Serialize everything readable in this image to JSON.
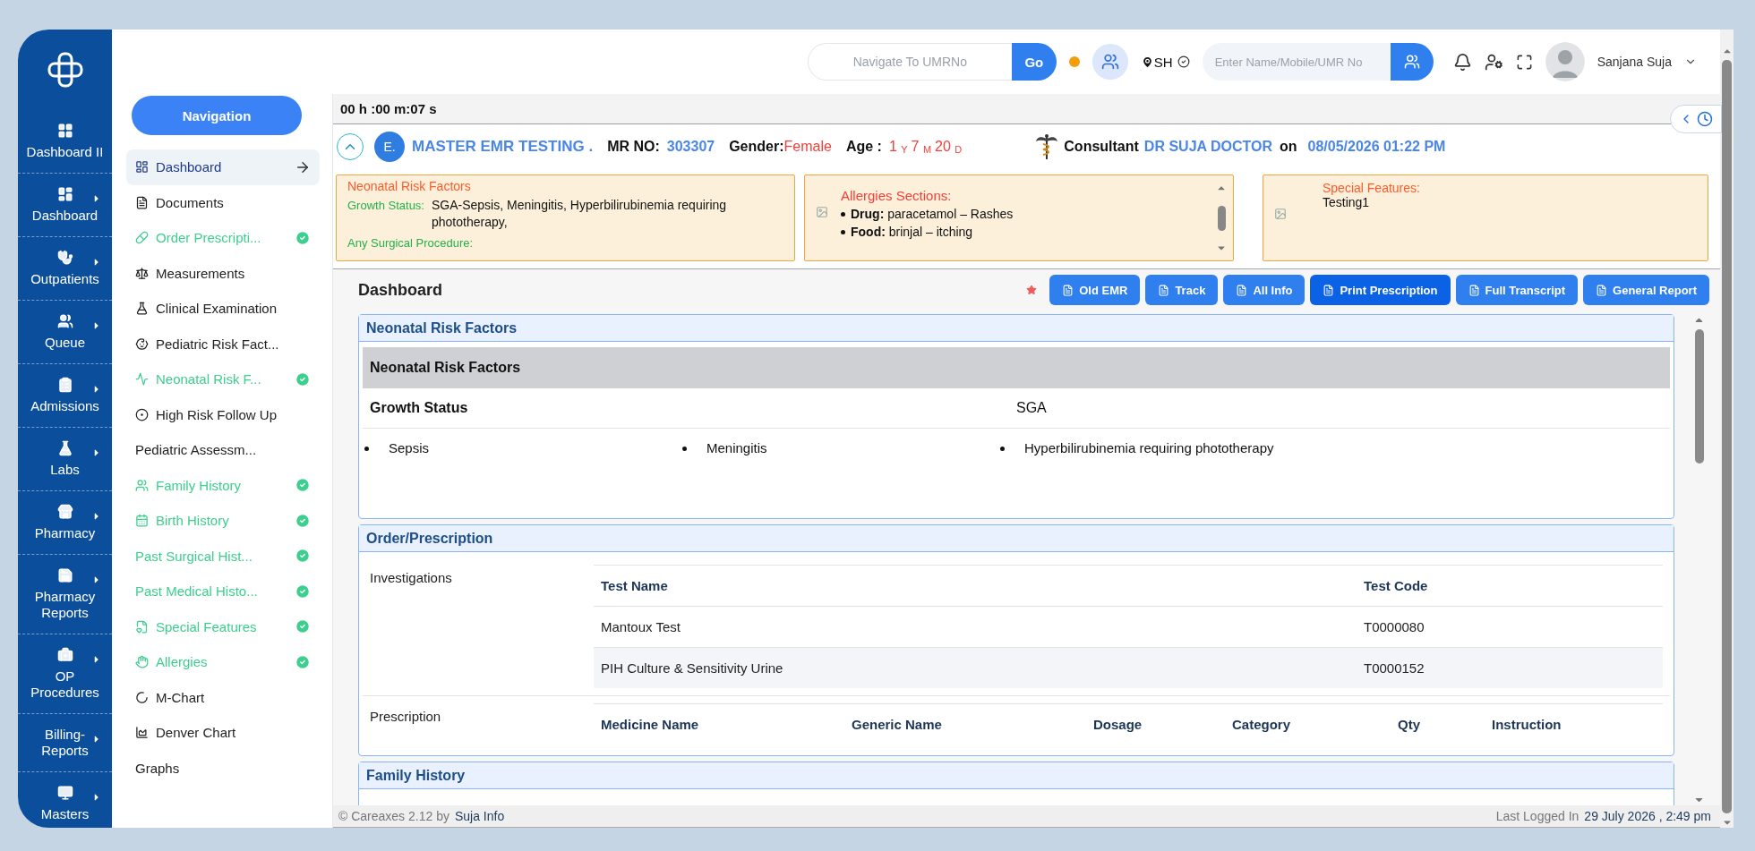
{
  "sidebar": {
    "items": [
      {
        "label": "Dashboard II",
        "submenu": false
      },
      {
        "label": "Dashboard",
        "submenu": true
      },
      {
        "label": "Outpatients",
        "submenu": true
      },
      {
        "label": "Queue",
        "submenu": true
      },
      {
        "label": "Admissions",
        "submenu": true
      },
      {
        "label": "Labs",
        "submenu": true
      },
      {
        "label": "Pharmacy",
        "submenu": true
      },
      {
        "label": "Pharmacy Reports",
        "submenu": true
      },
      {
        "label": "OP Procedures",
        "submenu": true
      },
      {
        "label": "Billing-Reports",
        "submenu": true
      },
      {
        "label": "Masters",
        "submenu": true
      }
    ]
  },
  "header": {
    "umr_search": {
      "placeholder": "Navigate To UMRNo",
      "button": "Go"
    },
    "location": "SH",
    "patient_search": {
      "placeholder": "Enter Name/Mobile/UMR No"
    },
    "user": "Sanjana Suja"
  },
  "navigation": {
    "title": "Navigation",
    "items": [
      {
        "label": "Dashboard",
        "selected": true,
        "completed": false
      },
      {
        "label": "Documents",
        "selected": false,
        "completed": false
      },
      {
        "label": "Order Prescripti...",
        "selected": false,
        "completed": true
      },
      {
        "label": "Measurements",
        "selected": false,
        "completed": false
      },
      {
        "label": "Clinical Examination",
        "selected": false,
        "completed": false
      },
      {
        "label": "Pediatric Risk Fact...",
        "selected": false,
        "completed": false
      },
      {
        "label": "Neonatal Risk F...",
        "selected": false,
        "completed": true
      },
      {
        "label": "High Risk Follow Up",
        "selected": false,
        "completed": false
      },
      {
        "label": "Pediatric Assessm...",
        "selected": false,
        "completed": false
      },
      {
        "label": "Family History",
        "selected": false,
        "completed": true
      },
      {
        "label": "Birth History",
        "selected": false,
        "completed": true
      },
      {
        "label": "Past Surgical Hist...",
        "selected": false,
        "completed": true
      },
      {
        "label": "Past Medical Histo...",
        "selected": false,
        "completed": true
      },
      {
        "label": "Special Features",
        "selected": false,
        "completed": true
      },
      {
        "label": "Allergies",
        "selected": false,
        "completed": true
      },
      {
        "label": "M-Chart",
        "selected": false,
        "completed": false
      },
      {
        "label": "Denver Chart",
        "selected": false,
        "completed": false
      },
      {
        "label": "Graphs",
        "selected": false,
        "completed": false
      }
    ]
  },
  "timer": "00 h :00 m:07 s",
  "patient": {
    "initial": "E.",
    "name": "MASTER EMR TESTING .",
    "mr_label": "MR NO:",
    "mr_no": "303307",
    "gender_label": "Gender:",
    "gender": "Female",
    "age_label": "Age :",
    "age": [
      {
        "value": "1",
        "unit": "Y"
      },
      {
        "value": "7",
        "unit": "M"
      },
      {
        "value": "20",
        "unit": "D"
      }
    ],
    "consultant_label": "Consultant",
    "consultant": "DR SUJA DOCTOR",
    "on_label": "on",
    "visit_time": "08/05/2026 01:22 PM"
  },
  "summary_cards": {
    "risk": {
      "title": "Neonatal Risk Factors",
      "growth_label": "Growth Status:",
      "growth_value": "SGA-Sepsis, Meningitis, Hyperbilirubinemia requiring phototherapy,",
      "surgical_label": "Any Surgical Procedure:"
    },
    "allergies": {
      "title": "Allergies Sections:",
      "items": [
        "**Drug:** paracetamol – Rashes",
        "**Food:** brinjal – itching"
      ]
    },
    "special": {
      "title": "Special Features:",
      "value": "Testing1"
    }
  },
  "toolbar": {
    "title": "Dashboard",
    "buttons": [
      {
        "label": "Old EMR",
        "selected": false
      },
      {
        "label": "Track",
        "selected": false
      },
      {
        "label": "All Info",
        "selected": false
      },
      {
        "label": "Print Prescription",
        "selected": true
      },
      {
        "label": "Full Transcript",
        "selected": false
      },
      {
        "label": "General Report",
        "selected": false
      }
    ]
  },
  "sections": [
    {
      "kind": "risk",
      "title": "Neonatal Risk Factors",
      "subtitle": "Neonatal Risk Factors",
      "rows": [
        {
          "label": "Growth Status",
          "value": "SGA"
        }
      ],
      "bullets": [
        "Sepsis",
        "Meningitis",
        "Hyperbilirubinemia requiring phototherapy"
      ]
    },
    {
      "kind": "order",
      "title": "Order/Prescription",
      "groups": [
        {
          "label": "Investigations",
          "columns": [
            "Test Name",
            "Test Code"
          ],
          "rows": [
            [
              "Mantoux Test",
              "T0000080"
            ],
            [
              "PIH Culture & Sensitivity Urine",
              "T0000152"
            ]
          ]
        },
        {
          "label": "Prescription",
          "columns": [
            "Medicine Name",
            "Generic Name",
            "Dosage",
            "Category",
            "Qty",
            "Instruction"
          ]
        }
      ]
    },
    {
      "kind": "header",
      "title": "Family History"
    }
  ],
  "footer": {
    "copyright": "© Careaxes 2.12 by",
    "company": "Suja Info",
    "login_label": "Last Logged In",
    "login_time": "29 July 2026 , 2:49 pm"
  }
}
